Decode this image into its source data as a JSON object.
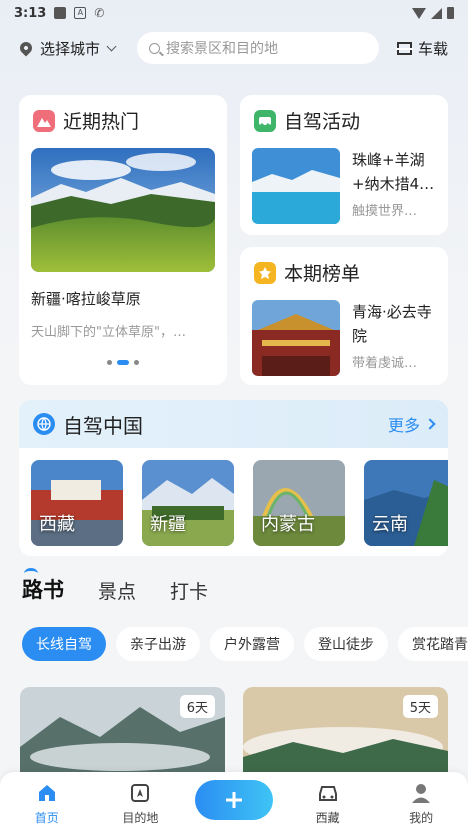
{
  "status_bar": {
    "time": "3:13"
  },
  "header": {
    "city_label": "选择城市",
    "search_placeholder": "搜索景区和目的地",
    "garage_label": "车载"
  },
  "hot": {
    "title": "近期热门",
    "name": "新疆·喀拉峻草原",
    "desc": "天山脚下的\"立体草原\"，…"
  },
  "activity": {
    "title": "自驾活动",
    "name": "珠峰+羊湖+纳木措4…",
    "desc": "触摸世界…"
  },
  "ranking": {
    "title": "本期榜单",
    "name": "青海·必去寺院",
    "desc": "带着虔诚…"
  },
  "china": {
    "title": "自驾中国",
    "more_label": "更多",
    "regions": [
      "西藏",
      "新疆",
      "内蒙古",
      "云南"
    ]
  },
  "tabs": [
    "路书",
    "景点",
    "打卡"
  ],
  "chips": [
    "长线自驾",
    "亲子出游",
    "户外露营",
    "登山徒步",
    "赏花踏青"
  ],
  "routes": [
    {
      "days": "6天"
    },
    {
      "days": "5天"
    }
  ],
  "nav": {
    "home": "首页",
    "destination": "目的地",
    "tibet": "西藏",
    "mine": "我的"
  },
  "colors": {
    "accent": "#2b8df2"
  }
}
